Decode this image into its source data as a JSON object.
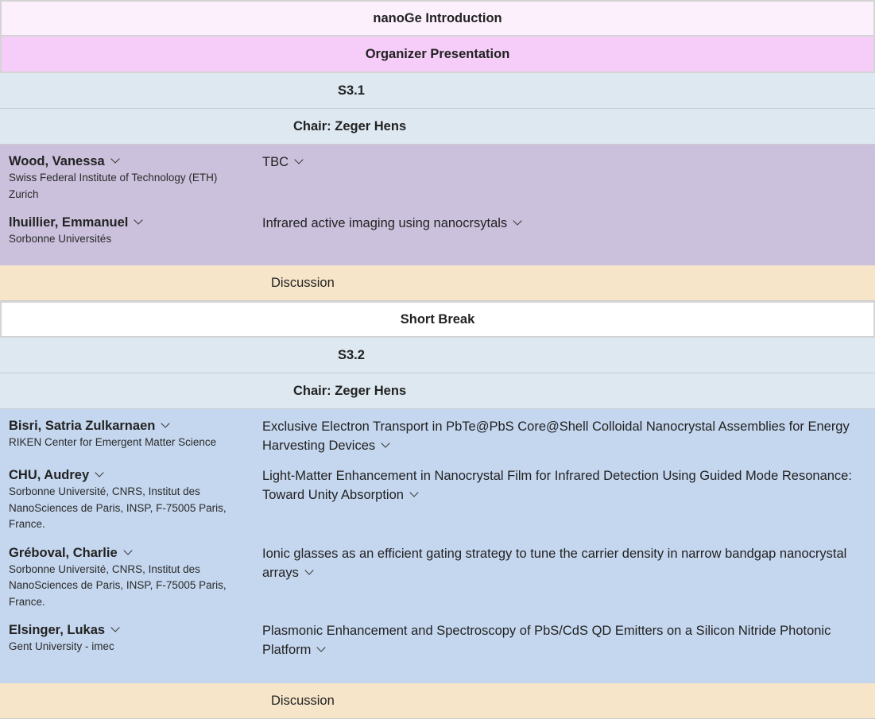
{
  "intro": "nanoGe Introduction",
  "organizer": "Organizer Presentation",
  "sessions": [
    {
      "label": "S3.1",
      "chair": "Chair: Zeger Hens",
      "talks": [
        {
          "speaker": "Wood, Vanessa",
          "affiliation": "Swiss Federal Institute of Technology (ETH) Zurich",
          "title": "TBC"
        },
        {
          "speaker": "lhuillier, Emmanuel",
          "affiliation": "Sorbonne Universités",
          "title": "Infrared active imaging using nanocrsytals"
        }
      ],
      "discussion": "Discussion"
    },
    {
      "label": "S3.2",
      "chair": "Chair: Zeger Hens",
      "talks": [
        {
          "speaker": "Bisri, Satria Zulkarnaen",
          "affiliation": "RIKEN Center for Emergent Matter Science",
          "title": "Exclusive Electron Transport in PbTe@PbS Core@Shell Colloidal Nanocrystal Assemblies for Energy Harvesting Devices"
        },
        {
          "speaker": "CHU, Audrey",
          "affiliation": "Sorbonne Université, CNRS, Institut des NanoSciences de Paris, INSP, F-75005 Paris, France.",
          "title": "Light-Matter Enhancement in Nanocrystal Film for Infrared Detection Using Guided Mode Resonance: Toward Unity Absorption"
        },
        {
          "speaker": "Gréboval, Charlie",
          "affiliation": "Sorbonne Université, CNRS, Institut des NanoSciences de Paris, INSP, F-75005 Paris, France.",
          "title": "Ionic glasses as an efficient gating strategy to tune the carrier density in narrow bandgap nanocrystal arrays"
        },
        {
          "speaker": "Elsinger, Lukas",
          "affiliation": "Gent University - imec",
          "title": "Plasmonic Enhancement and Spectroscopy of PbS/CdS QD Emitters on a Silicon Nitride Photonic Platform"
        }
      ],
      "discussion": "Discussion"
    }
  ],
  "short_break": "Short Break",
  "icons": {
    "expand": "chevron-down-icon"
  },
  "colors": {
    "intro_bg": "#fdf0fd",
    "organizer_bg": "#f6cdf8",
    "session_bg": "#dde8f0",
    "s31_bg": "#cbc1dd",
    "s32_bg": "#c5d7ef",
    "discussion_bg": "#f6e5c8"
  }
}
